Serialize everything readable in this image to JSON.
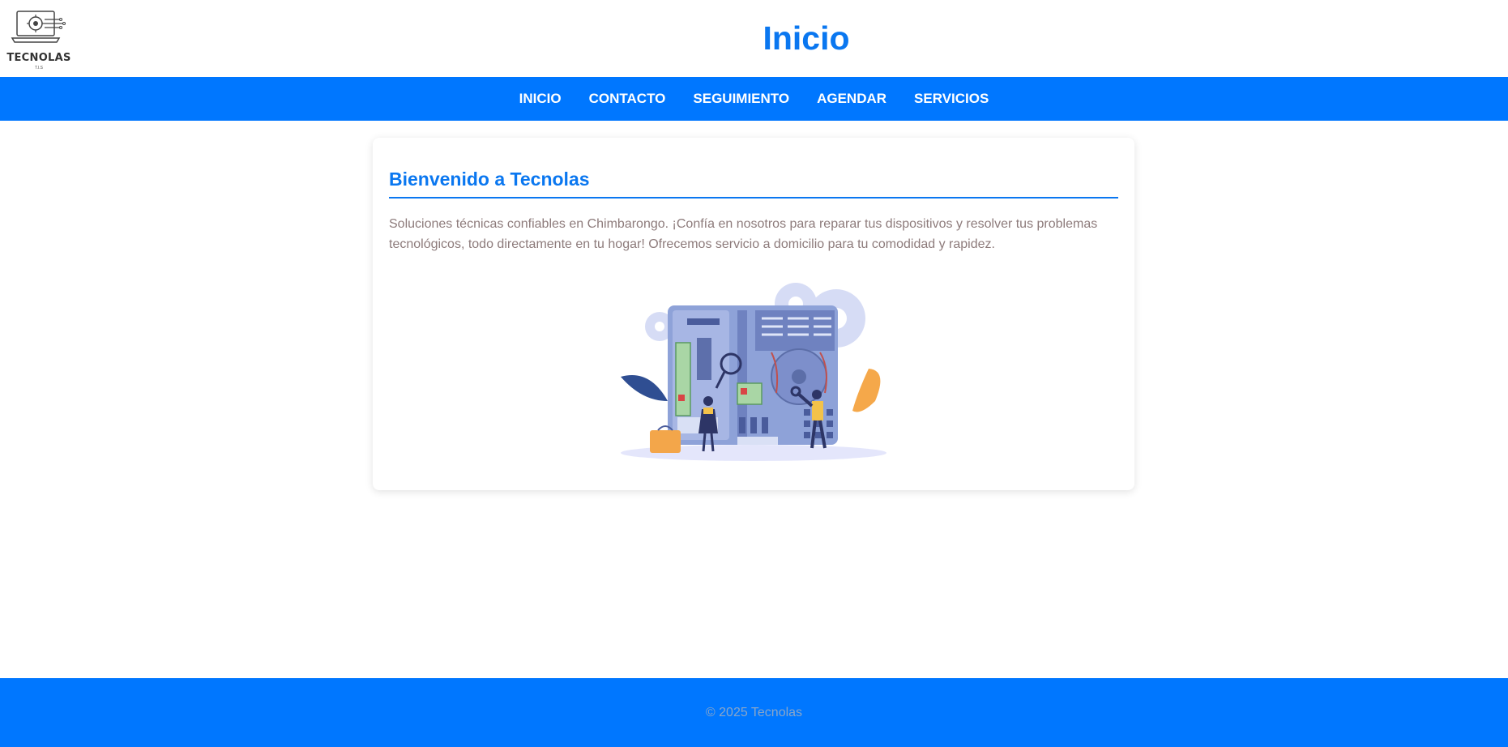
{
  "brand": {
    "logo_text": "TECNOLAS",
    "logo_subtext": "T.I.S"
  },
  "header": {
    "title": "Inicio"
  },
  "nav": {
    "items": [
      {
        "label": "INICIO"
      },
      {
        "label": "CONTACTO"
      },
      {
        "label": "SEGUIMIENTO"
      },
      {
        "label": "AGENDAR"
      },
      {
        "label": "SERVICIOS"
      }
    ]
  },
  "main": {
    "heading": "Bienvenido a Tecnolas",
    "paragraph": "Soluciones técnicas confiables en Chimbarongo. ¡Confía en nosotros para reparar tus dispositivos y resolver tus problemas tecnológicos, todo directamente en tu hogar! Ofrecemos servicio a domicilio para tu comodidad y rapidez."
  },
  "footer": {
    "text": "© 2025 Tecnolas"
  },
  "colors": {
    "primary": "#0077ff",
    "title": "#0a77f0",
    "body_text": "#8d7b7b",
    "footer_text": "#8aa6c8"
  }
}
